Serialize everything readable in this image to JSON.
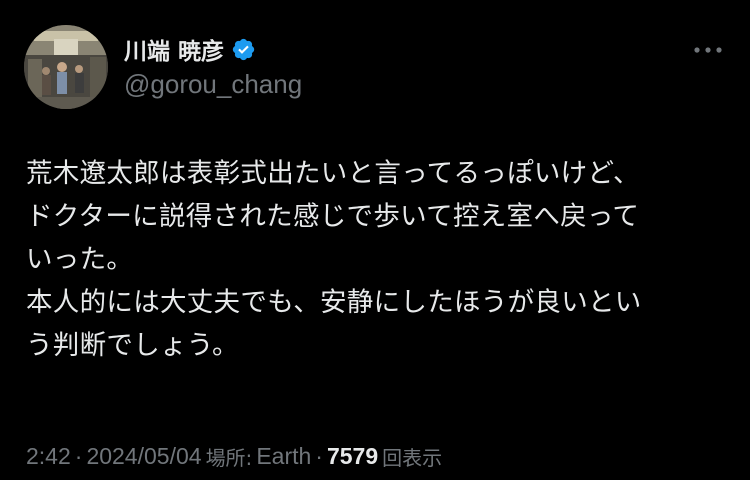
{
  "author": {
    "display_name": "川端 暁彦",
    "handle": "@gorou_chang",
    "verified": true,
    "verified_color": "#1d9bf0"
  },
  "header": {
    "more_icon": "more-horizontal-icon"
  },
  "tweet": {
    "lines": [
      "荒木遼太郎は表彰式出たいと言ってるっぽいけど、",
      "ドクターに説得された感じで歩いて控え室へ戻って",
      "いった。",
      "本人的には大丈夫でも、安静にしたほうが良いとい",
      "う判断でしょう。"
    ]
  },
  "meta": {
    "time": "2:42",
    "separator": "·",
    "date": "2024/05/04",
    "location_label": "場所:",
    "location": "Earth",
    "views_count": "7579",
    "views_label": "回表示"
  },
  "colors": {
    "background": "#000000",
    "primary_text": "#e7e9ea",
    "secondary_text": "#71767b"
  }
}
